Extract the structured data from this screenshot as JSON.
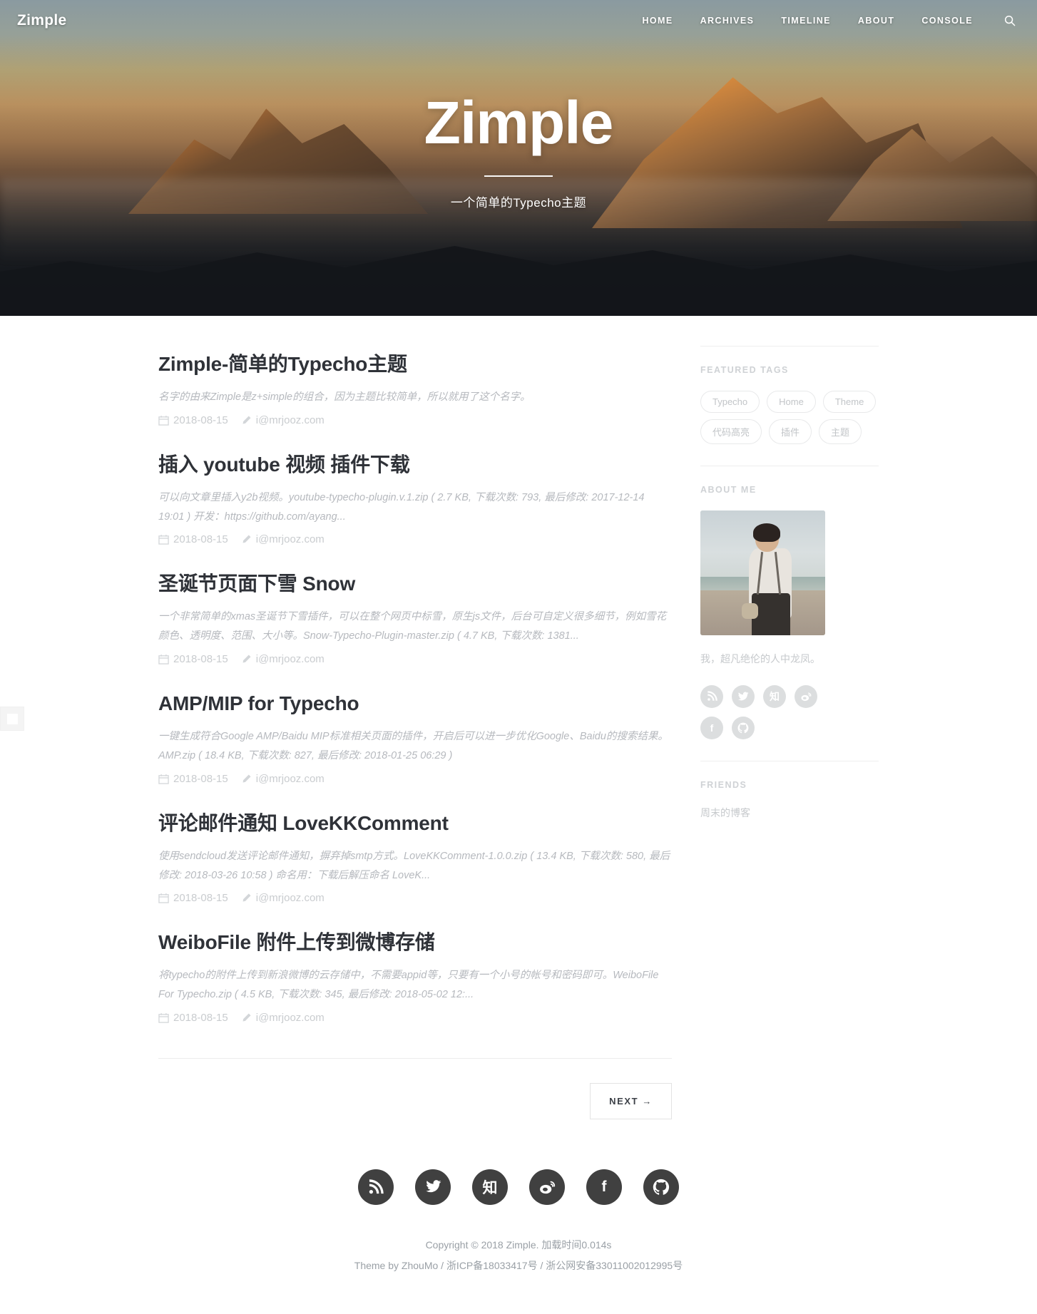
{
  "site": {
    "brand": "Zimple",
    "hero_title": "Zimple",
    "hero_subtitle": "一个简单的Typecho主题"
  },
  "nav": {
    "items": [
      {
        "label": "HOME"
      },
      {
        "label": "ARCHIVES"
      },
      {
        "label": "TIMELINE"
      },
      {
        "label": "ABOUT"
      },
      {
        "label": "CONSOLE"
      }
    ],
    "search_icon": "search-icon"
  },
  "posts": [
    {
      "title": "Zimple-简单的Typecho主题",
      "excerpt": "名字的由来Zimple是z+simple的组合，因为主题比较简单，所以就用了这个名字。",
      "date": "2018-08-15",
      "author": "i@mrjooz.com"
    },
    {
      "title": "插入 youtube 视频 插件下载",
      "excerpt": "可以向文章里插入y2b视频。youtube-typecho-plugin.v.1.zip ( 2.7 KB, 下载次数: 793, 最后修改: 2017-12-14 19:01 ) 开发：https://github.com/ayang...",
      "date": "2018-08-15",
      "author": "i@mrjooz.com"
    },
    {
      "title": "圣诞节页面下雪 Snow",
      "excerpt": "一个非常简单的xmas圣诞节下雪插件，可以在整个网页中标雪，原生js文件，后台可自定义很多细节，例如雪花颜色、透明度、范围、大小等。Snow-Typecho-Plugin-master.zip ( 4.7 KB, 下载次数: 1381...",
      "date": "2018-08-15",
      "author": "i@mrjooz.com"
    },
    {
      "title": "AMP/MIP for Typecho",
      "excerpt": "一键生成符合Google AMP/Baidu MIP标准相关页面的插件，开启后可以进一步优化Google、Baidu的搜索结果。AMP.zip ( 18.4 KB, 下载次数: 827, 最后修改: 2018-01-25 06:29 )",
      "date": "2018-08-15",
      "author": "i@mrjooz.com"
    },
    {
      "title": "评论邮件通知 LoveKKComment",
      "excerpt": "使用sendcloud发送评论邮件通知，摒弃掉smtp方式。LoveKKComment-1.0.0.zip ( 13.4 KB, 下载次数: 580, 最后修改: 2018-03-26 10:58 ) 命名用：下载后解压命名 LoveK...",
      "date": "2018-08-15",
      "author": "i@mrjooz.com"
    },
    {
      "title": "WeiboFile 附件上传到微博存储",
      "excerpt": "将typecho的附件上传到新浪微博的云存储中，不需要appid等，只要有一个小号的帐号和密码即可。WeiboFile For Typecho.zip ( 4.5 KB, 下载次数: 345, 最后修改: 2018-05-02 12:...",
      "date": "2018-08-15",
      "author": "i@mrjooz.com"
    }
  ],
  "pager": {
    "next_label": "NEXT →"
  },
  "sidebar": {
    "featured_tags": {
      "title": "FEATURED TAGS",
      "tags": [
        {
          "label": "Typecho"
        },
        {
          "label": "Home"
        },
        {
          "label": "Theme"
        },
        {
          "label": "代码高亮"
        },
        {
          "label": "插件"
        },
        {
          "label": "主题"
        }
      ]
    },
    "about_me": {
      "title": "ABOUT ME",
      "bio": "我，超凡绝伦的人中龙凤。",
      "socials": [
        {
          "name": "rss-icon",
          "glyph": "rss"
        },
        {
          "name": "twitter-icon",
          "glyph": "twitter"
        },
        {
          "name": "zhihu-icon",
          "glyph": "知"
        },
        {
          "name": "weibo-icon",
          "glyph": "weibo"
        },
        {
          "name": "facebook-icon",
          "glyph": "f"
        },
        {
          "name": "github-icon",
          "glyph": "github"
        }
      ]
    },
    "friends": {
      "title": "FRIENDS",
      "links": [
        {
          "label": "周末的博客"
        }
      ]
    }
  },
  "footer": {
    "socials": [
      {
        "name": "rss-icon",
        "glyph": "rss"
      },
      {
        "name": "twitter-icon",
        "glyph": "twitter"
      },
      {
        "name": "zhihu-icon",
        "glyph": "知"
      },
      {
        "name": "weibo-icon",
        "glyph": "weibo"
      },
      {
        "name": "facebook-icon",
        "glyph": "f"
      },
      {
        "name": "github-icon",
        "glyph": "github"
      }
    ],
    "copyright": "Copyright © 2018 Zimple. 加载时间0.014s",
    "credit_prefix": "Theme by ZhouMo / ",
    "icp": "浙ICP备18033417号",
    "credit_sep": " / ",
    "gongan": "浙公网安备33011002012995号"
  },
  "colors": {
    "text_dark": "#2f3238",
    "muted": "#c6c9cc",
    "social_dark": "#404040",
    "social_light": "#dcdedf"
  }
}
